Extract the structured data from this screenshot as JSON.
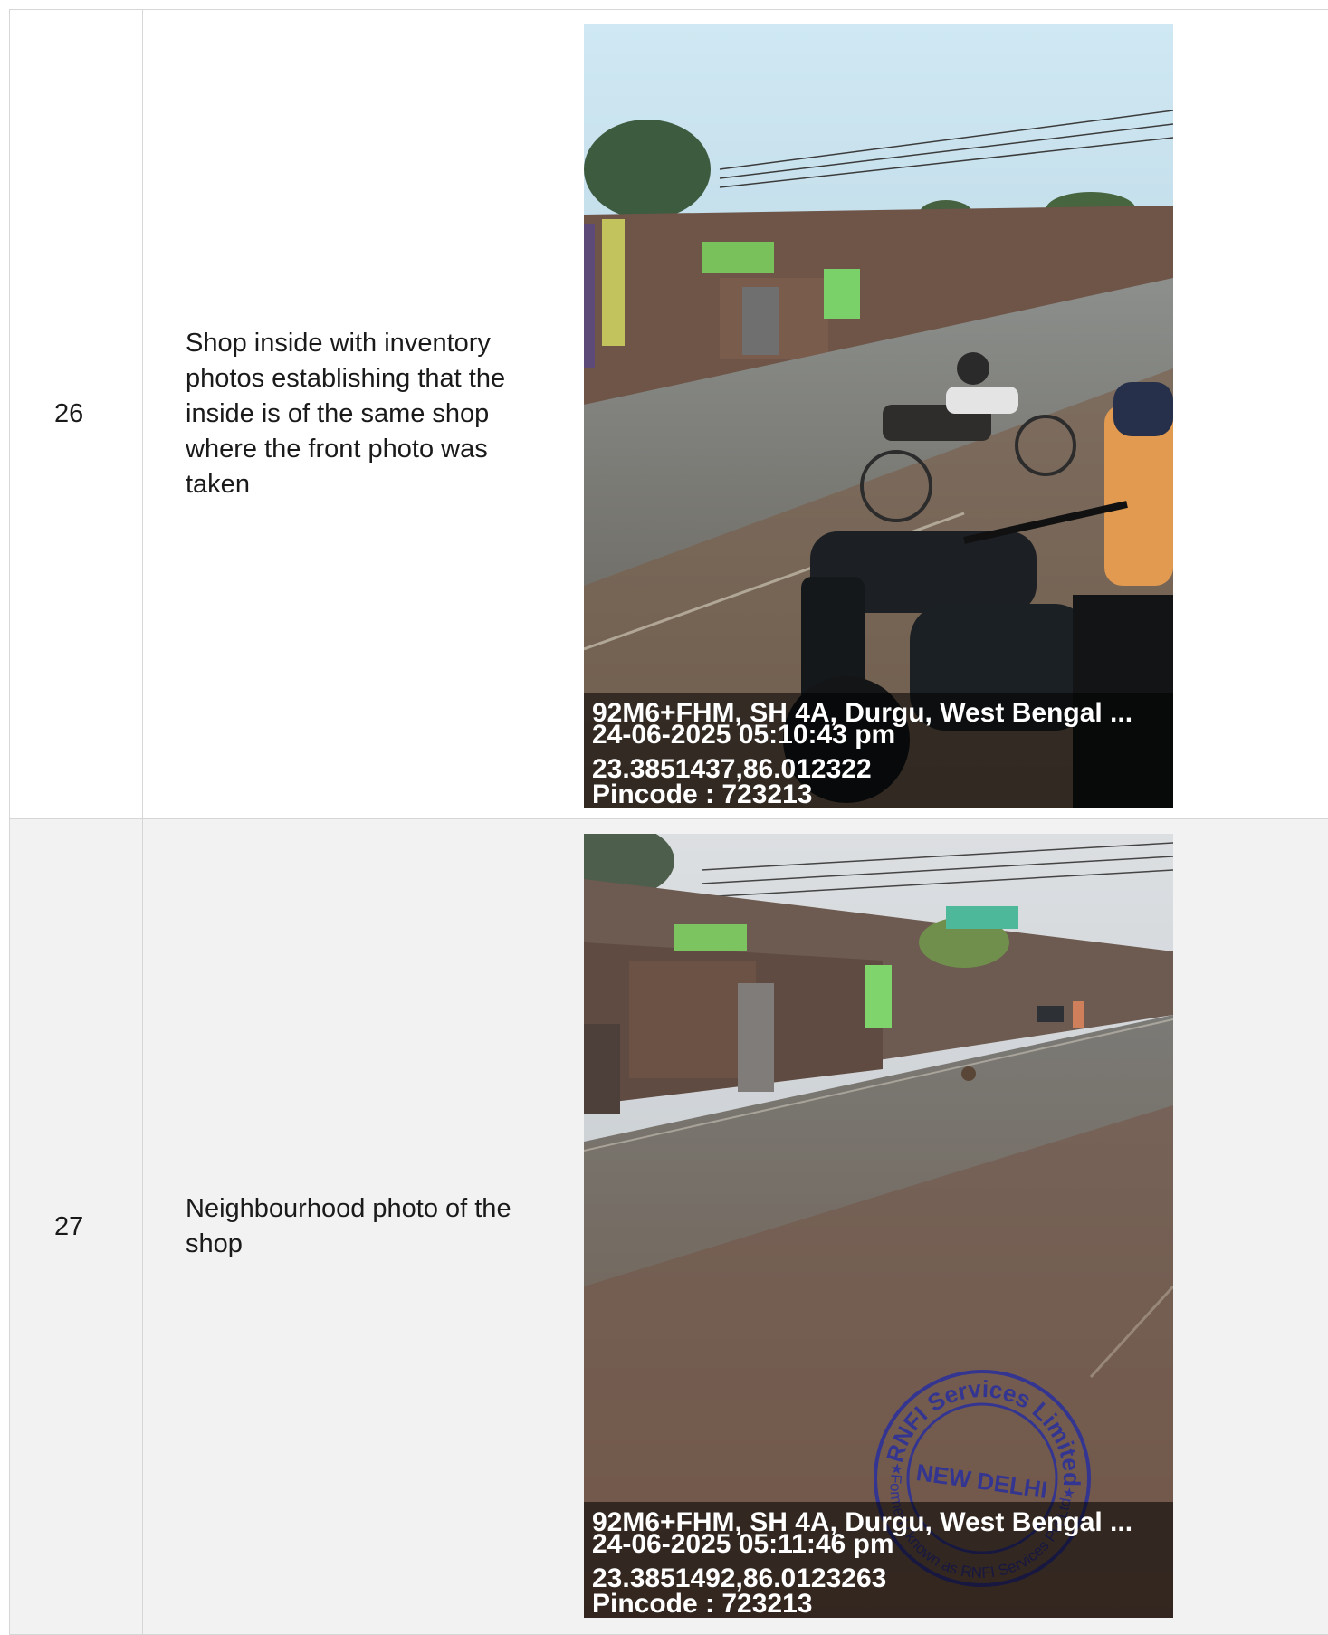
{
  "rows": [
    {
      "sl_no": "26",
      "description": "Shop inside with inventory photos establishing that the inside is of the same shop where the front photo was taken",
      "photo_stamp": {
        "address": "92M6+FHM, SH 4A, Durgu, West Bengal ...",
        "datetime": "24-06-2025 05:10:43 pm",
        "coordinates": "23.3851437,86.012322",
        "pincode": "Pincode : 723213"
      }
    },
    {
      "sl_no": "27",
      "description": "Neighbourhood photo of the shop",
      "photo_stamp": {
        "address": "92M6+FHM, SH 4A, Durgu, West Bengal ...",
        "datetime": "24-06-2025 05:11:46 pm",
        "coordinates": "23.3851492,86.0123263",
        "pincode": "Pincode : 723213"
      },
      "seal": {
        "outer_text": "RNFI Services Limited",
        "inner_text": "NEW DELHI",
        "lower_text": "(Formerly known as RNFI Services Pvt Ltd)",
        "color": "#2a2f9c"
      }
    }
  ]
}
